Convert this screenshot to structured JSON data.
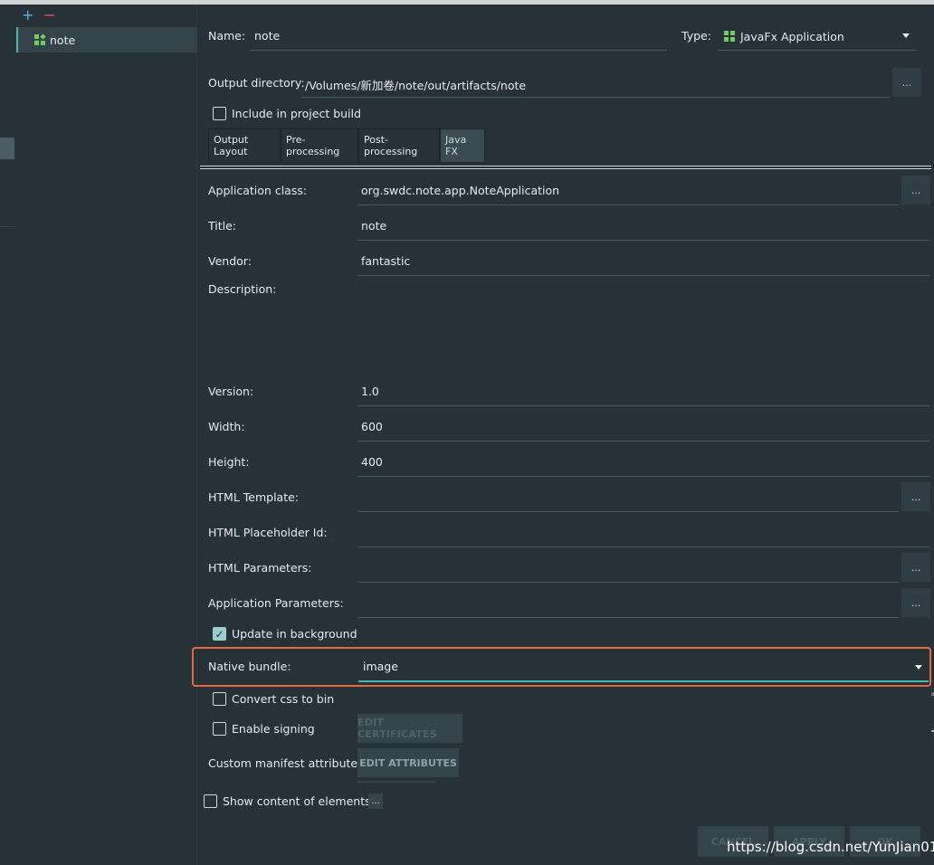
{
  "toolbar": {
    "add_glyph": "+",
    "remove_glyph": "−"
  },
  "artifacts": {
    "items": [
      {
        "label": "note",
        "icon": "javafx-app-icon"
      }
    ]
  },
  "form": {
    "name_label": "Name:",
    "name_value": "note",
    "type_label": "Type:",
    "type_value": "JavaFx Application",
    "output_dir_label": "Output directory:",
    "output_dir_value": "/Volumes/新加卷/note/out/artifacts/note",
    "browse_label": "...",
    "include_build_label": "Include in project build"
  },
  "tabs": [
    {
      "label": "Output Layout"
    },
    {
      "label": "Pre-processing"
    },
    {
      "label": "Post-processing"
    },
    {
      "label": "Java FX"
    }
  ],
  "javafx": {
    "app_class_label": "Application class:",
    "app_class_value": "org.swdc.note.app.NoteApplication",
    "title_label": "Title:",
    "title_value": "note",
    "vendor_label": "Vendor:",
    "vendor_value": "fantastic",
    "description_label": "Description:",
    "version_label": "Version:",
    "version_value": "1.0",
    "width_label": "Width:",
    "width_value": "600",
    "height_label": "Height:",
    "height_value": "400",
    "html_template_label": "HTML Template:",
    "html_placeholder_label": "HTML Placeholder Id:",
    "html_params_label": "HTML Parameters:",
    "app_params_label": "Application Parameters:",
    "update_bg_label": "Update in background",
    "native_bundle_label": "Native bundle:",
    "native_bundle_value": "image",
    "convert_css_label": "Convert css to bin",
    "enable_signing_label": "Enable signing",
    "edit_certs_label": "EDIT CERTIFICATES",
    "custom_manifest_label": "Custom manifest attributes",
    "edit_attrs_label": "EDIT  ATTRIBUTES",
    "show_content_label": "Show content of elements",
    "show_content_btn": "..."
  },
  "buttons": {
    "cancel": "CANCEL",
    "apply": "APPLY",
    "ok": "OK"
  },
  "watermark": "https://blog.csdn.net/YunJian01",
  "colors": {
    "accent": "#4db6ac",
    "highlight": "#e8693a",
    "background": "#263238"
  }
}
